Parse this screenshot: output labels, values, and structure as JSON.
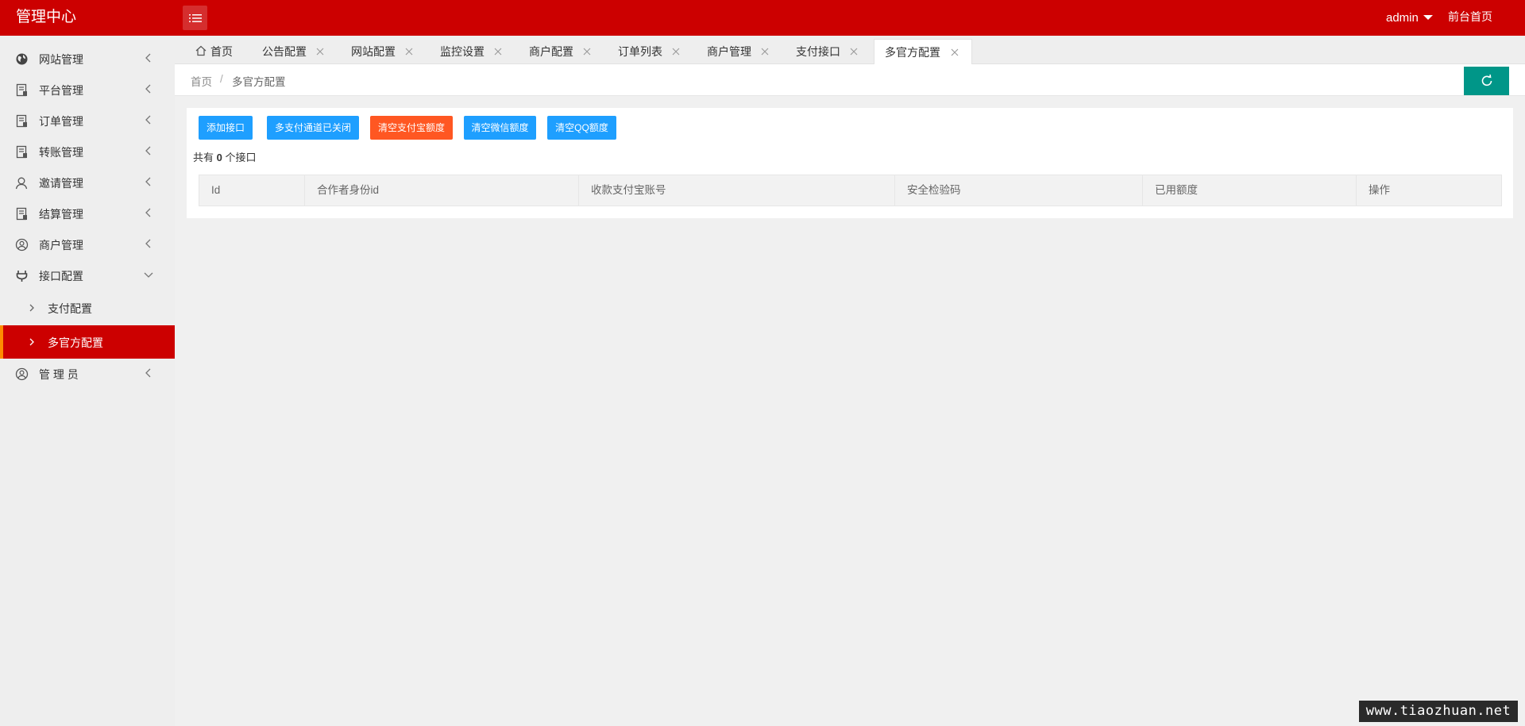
{
  "header": {
    "app_title": "管理中心",
    "user_name": "admin",
    "front_link": "前台首页",
    "menu_icon": "list-menu-icon"
  },
  "sidebar": {
    "items": [
      {
        "label": "网站管理",
        "icon": "globe-icon",
        "expanded": false
      },
      {
        "label": "平台管理",
        "icon": "document-icon",
        "expanded": false
      },
      {
        "label": "订单管理",
        "icon": "document-icon",
        "expanded": false
      },
      {
        "label": "转账管理",
        "icon": "document-icon",
        "expanded": false
      },
      {
        "label": "邀请管理",
        "icon": "user-icon",
        "expanded": false
      },
      {
        "label": "结算管理",
        "icon": "document-icon",
        "expanded": false
      },
      {
        "label": "商户管理",
        "icon": "user-circle-icon",
        "expanded": false
      },
      {
        "label": "接口配置",
        "icon": "plug-icon",
        "expanded": true
      },
      {
        "label": "管 理 员",
        "icon": "user-circle-icon",
        "expanded": false
      }
    ],
    "sub_items": [
      {
        "label": "支付配置",
        "active": false
      },
      {
        "label": "多官方配置",
        "active": true
      }
    ]
  },
  "tabs": [
    {
      "label": "首页",
      "icon": "home-icon",
      "closable": false
    },
    {
      "label": "公告配置",
      "closable": true
    },
    {
      "label": "网站配置",
      "closable": true
    },
    {
      "label": "监控设置",
      "closable": true
    },
    {
      "label": "商户配置",
      "closable": true
    },
    {
      "label": "订单列表",
      "closable": true
    },
    {
      "label": "商户管理",
      "closable": true
    },
    {
      "label": "支付接口",
      "closable": true
    },
    {
      "label": "多官方配置",
      "closable": true,
      "active": true
    }
  ],
  "breadcrumb": {
    "home": "首页",
    "separator": "/",
    "current": "多官方配置"
  },
  "toolbar": {
    "add_label": "添加接口",
    "multi_pay_label": "多支付通道已关闭",
    "clear_alipay_label": "清空支付宝额度",
    "clear_wechat_label": "清空微信额度",
    "clear_qq_label": "清空QQ额度"
  },
  "summary": {
    "prefix": "共有",
    "count": "0",
    "suffix": "个接口"
  },
  "table": {
    "columns": [
      "Id",
      "合作者身份id",
      "收款支付宝账号",
      "安全检验码",
      "已用额度",
      "操作"
    ],
    "rows": []
  },
  "watermark": "www.tiaozhuan.net",
  "colors": {
    "brand_red": "#cc0000",
    "blue_button": "#1e9fff",
    "orange_button": "#ff5722",
    "refresh_teal": "#009688",
    "active_marker": "#ff8c00"
  }
}
